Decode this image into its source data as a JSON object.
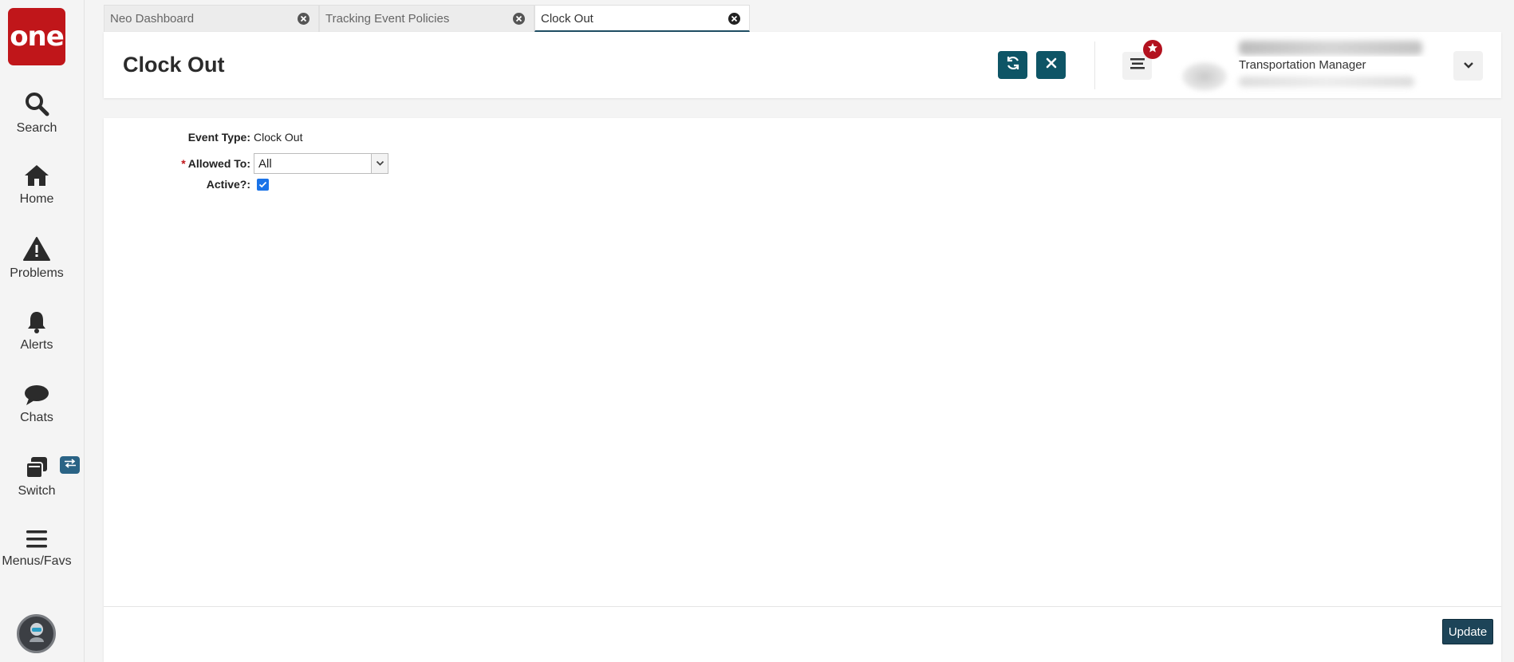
{
  "app": {
    "logo_text": "one",
    "brand_color": "#c0161a",
    "accent_color": "#0e5566"
  },
  "nav": {
    "items": [
      {
        "label": "Search",
        "icon": "search-icon"
      },
      {
        "label": "Home",
        "icon": "home-icon"
      },
      {
        "label": "Problems",
        "icon": "warning-icon"
      },
      {
        "label": "Alerts",
        "icon": "bell-icon"
      },
      {
        "label": "Chats",
        "icon": "chat-icon"
      },
      {
        "label": "Switch",
        "icon": "switch-icon"
      },
      {
        "label": "Menus/Favs",
        "icon": "hamburger-icon"
      }
    ]
  },
  "tabs": [
    {
      "label": "Neo Dashboard",
      "active": false
    },
    {
      "label": "Tracking Event Policies",
      "active": false
    },
    {
      "label": "Clock Out",
      "active": true
    }
  ],
  "header": {
    "title": "Clock Out",
    "refresh_icon": "refresh-icon",
    "close_icon": "close-icon",
    "user_role": "Transportation Manager"
  },
  "form": {
    "event_type_label": "Event Type:",
    "event_type_value": "Clock Out",
    "allowed_to_required": "*",
    "allowed_to_label": "Allowed To:",
    "allowed_to_value": "All",
    "active_label": "Active?:",
    "active_checked": true
  },
  "footer": {
    "update_label": "Update"
  }
}
